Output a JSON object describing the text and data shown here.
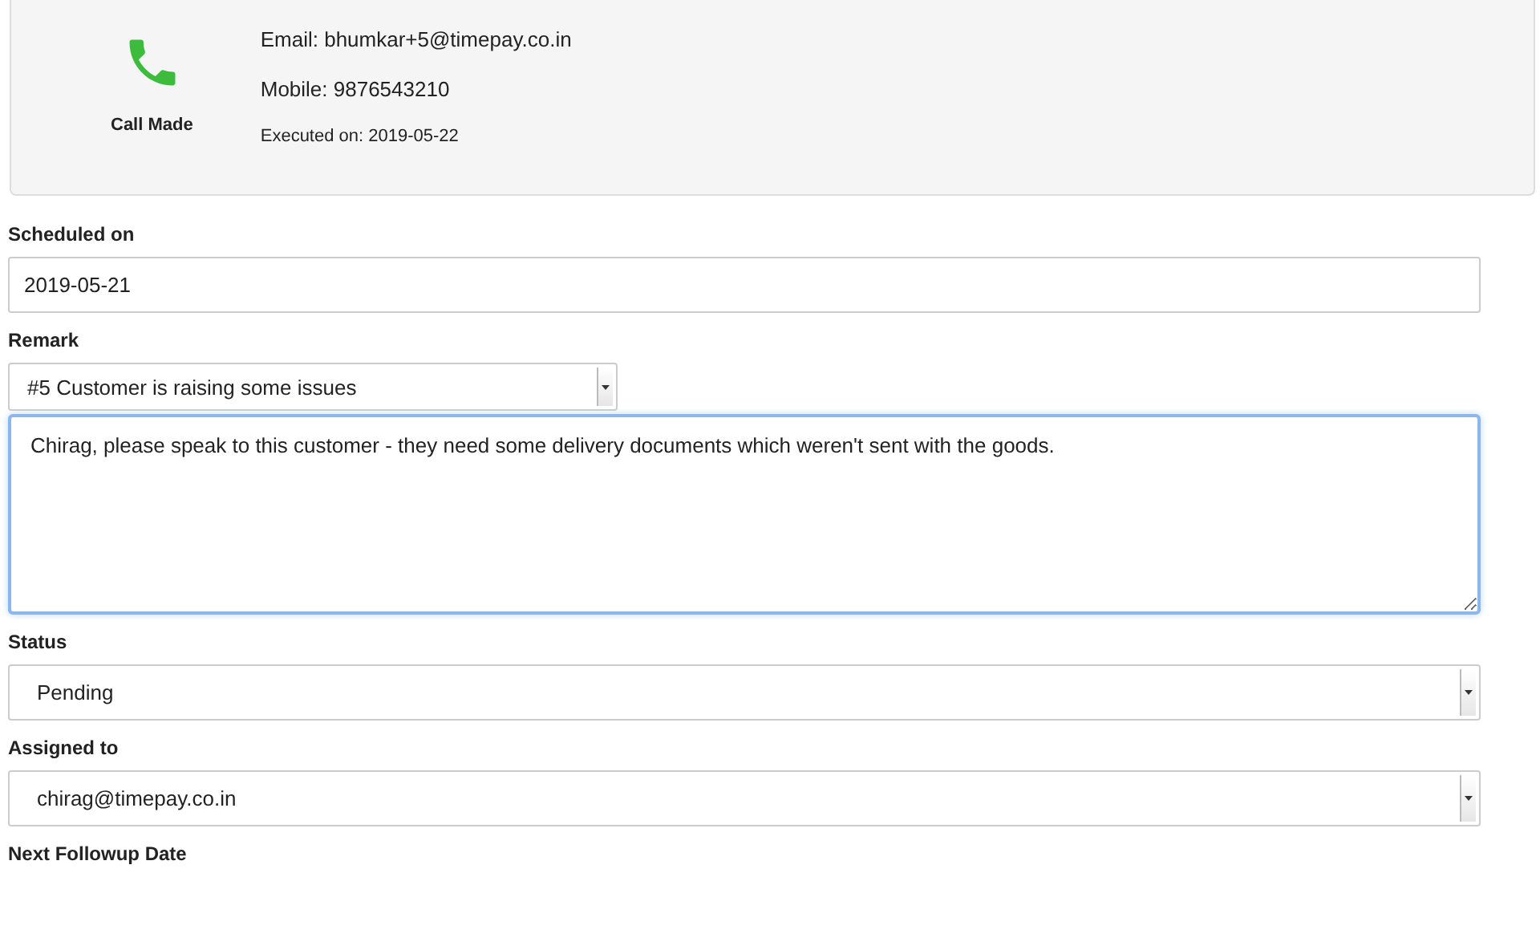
{
  "activity": {
    "type_label": "Call Made",
    "email": "Email: bhumkar+5@timepay.co.in",
    "mobile": "Mobile: 9876543210",
    "executed": "Executed on: 2019-05-22"
  },
  "fields": [
    {
      "kind": "text",
      "label": "Scheduled on",
      "value": "2019-05-21"
    },
    {
      "kind": "select",
      "label": "Remark",
      "value": "#5 Customer is raising some issues",
      "narrow": true
    },
    {
      "kind": "textarea",
      "value": "Chirag, please speak to this customer - they need some delivery documents which weren't sent with the goods.",
      "focused": true
    },
    {
      "kind": "select",
      "label": "Status",
      "value": "Pending",
      "narrow": false
    },
    {
      "kind": "select",
      "label": "Assigned to",
      "value": "chirag@timepay.co.in",
      "narrow": false
    },
    {
      "kind": "label",
      "label": "Next Followup Date"
    }
  ]
}
